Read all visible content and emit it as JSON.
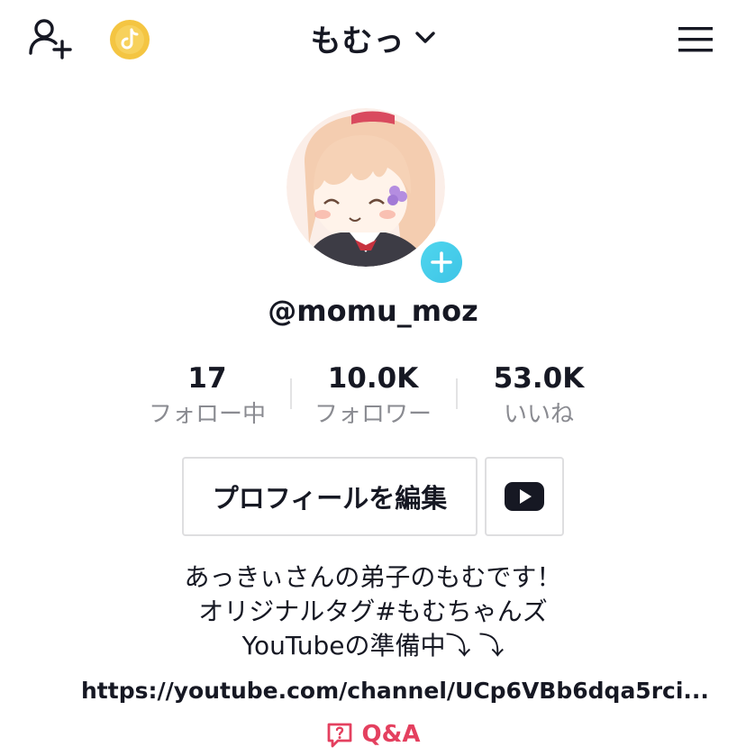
{
  "header": {
    "title": "もむっ"
  },
  "profile": {
    "username": "@momu_moz",
    "stats": [
      {
        "value": "17",
        "label": "フォロー中"
      },
      {
        "value": "10.0K",
        "label": "フォロワー"
      },
      {
        "value": "53.0K",
        "label": "いいね"
      }
    ],
    "edit_button_label": "プロフィールを編集",
    "bio_lines": [
      "あっきぃさんの弟子のもむです！",
      "オリジナルタグ#もむちゃんズ",
      "YouTubeの準備中⤵︎ ⤵︎"
    ],
    "link_text": "https://youtube.com/channel/UCp6VBb6dqa5rci...",
    "qa_label": "Q&A"
  },
  "colors": {
    "accent_red": "#e4405f",
    "plus_badge": "#4fd6ee",
    "coin": "#f4c542"
  },
  "icons": [
    "add-user-icon",
    "coin-icon",
    "chevron-down-icon",
    "menu-icon",
    "plus-icon",
    "youtube-icon",
    "link-icon",
    "qa-icon"
  ]
}
